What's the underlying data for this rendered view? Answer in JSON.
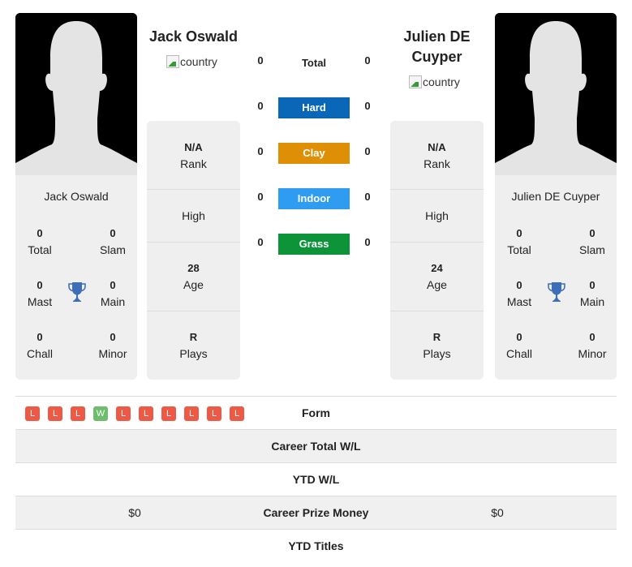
{
  "player1": {
    "name": "Jack Oswald",
    "country_alt": "country",
    "card_name": "Jack Oswald",
    "titles": {
      "total": {
        "value": "0",
        "label": "Total"
      },
      "slam": {
        "value": "0",
        "label": "Slam"
      },
      "mast": {
        "value": "0",
        "label": "Mast"
      },
      "main": {
        "value": "0",
        "label": "Main"
      },
      "chall": {
        "value": "0",
        "label": "Chall"
      },
      "minor": {
        "value": "0",
        "label": "Minor"
      }
    },
    "info": {
      "rank": {
        "value": "N/A",
        "label": "Rank"
      },
      "high": {
        "label": "High"
      },
      "age": {
        "value": "28",
        "label": "Age"
      },
      "plays": {
        "value": "R",
        "label": "Plays"
      }
    }
  },
  "player2": {
    "name": "Julien DE Cuyper",
    "country_alt": "country",
    "card_name": "Julien DE Cuyper",
    "titles": {
      "total": {
        "value": "0",
        "label": "Total"
      },
      "slam": {
        "value": "0",
        "label": "Slam"
      },
      "mast": {
        "value": "0",
        "label": "Mast"
      },
      "main": {
        "value": "0",
        "label": "Main"
      },
      "chall": {
        "value": "0",
        "label": "Chall"
      },
      "minor": {
        "value": "0",
        "label": "Minor"
      }
    },
    "info": {
      "rank": {
        "value": "N/A",
        "label": "Rank"
      },
      "high": {
        "label": "High"
      },
      "age": {
        "value": "24",
        "label": "Age"
      },
      "plays": {
        "value": "R",
        "label": "Plays"
      }
    }
  },
  "surfaces": [
    {
      "label": "Total",
      "p1": "0",
      "p2": "0",
      "color": null
    },
    {
      "label": "Hard",
      "p1": "0",
      "p2": "0",
      "color": "#0a67b8"
    },
    {
      "label": "Clay",
      "p1": "0",
      "p2": "0",
      "color": "#de8f05"
    },
    {
      "label": "Indoor",
      "p1": "0",
      "p2": "0",
      "color": "#2e9cf0"
    },
    {
      "label": "Grass",
      "p1": "0",
      "p2": "0",
      "color": "#0d9439"
    }
  ],
  "form": {
    "label": "Form",
    "p1": [
      "L",
      "L",
      "L",
      "W",
      "L",
      "L",
      "L",
      "L",
      "L",
      "L"
    ],
    "colors": {
      "L": "#ec5a45",
      "W": "#6dbd6d"
    }
  },
  "table": [
    {
      "label": "Career Total W/L",
      "p1": "",
      "p2": ""
    },
    {
      "label": "YTD W/L",
      "p1": "",
      "p2": ""
    },
    {
      "label": "Career Prize Money",
      "p1": "$0",
      "p2": "$0"
    },
    {
      "label": "YTD Titles",
      "p1": "",
      "p2": ""
    }
  ],
  "colors": {
    "trophy": "#3d6fb8",
    "panel_bg": "#efefef"
  }
}
